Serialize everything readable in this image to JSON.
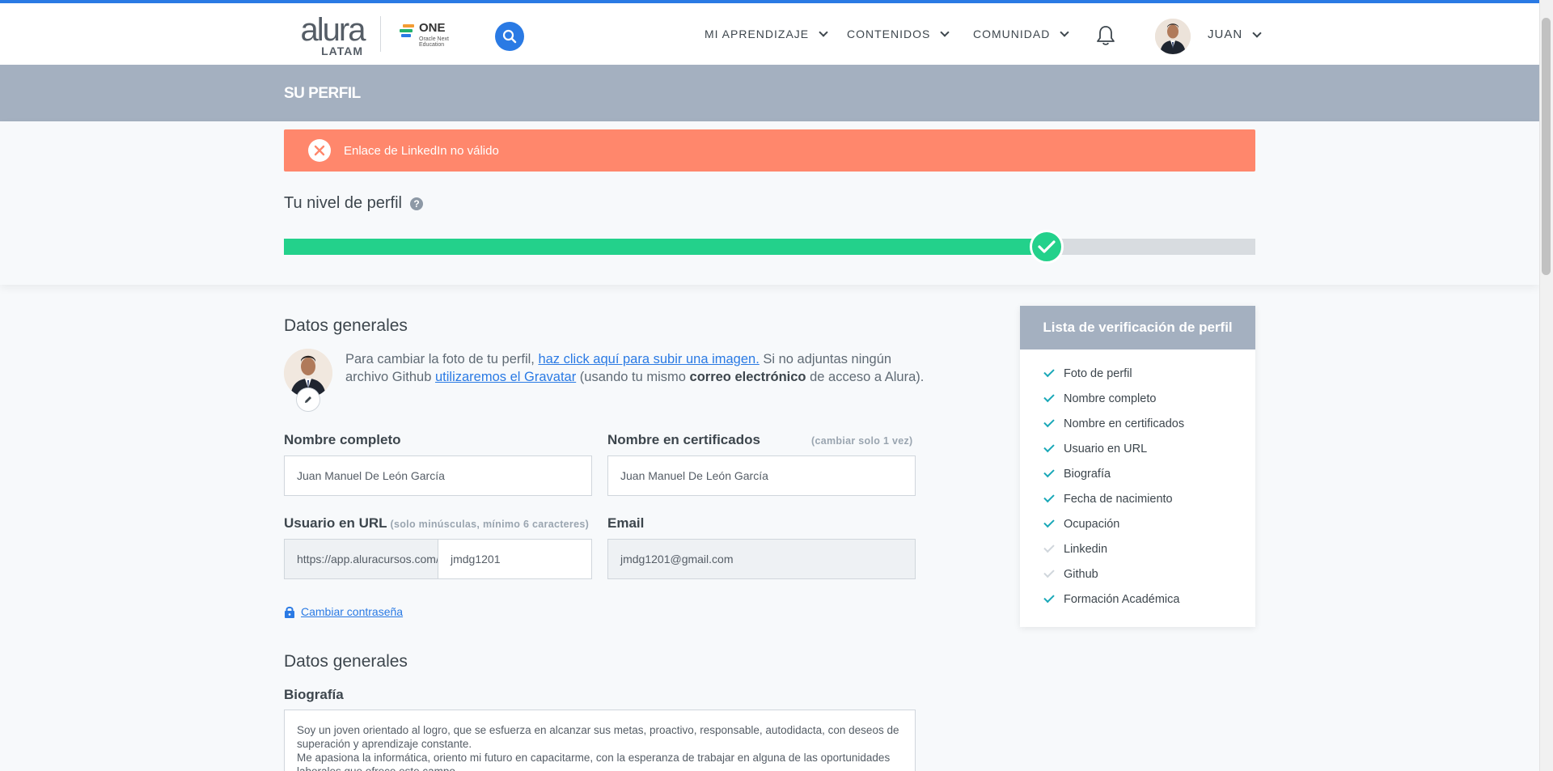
{
  "header": {
    "logo": {
      "alura": "alura",
      "latam": "LATAM"
    },
    "one_logo": {
      "title": "ONE",
      "subtitle": "Oracle Next Education"
    },
    "nav": [
      {
        "label": "MI APRENDIZAJE"
      },
      {
        "label": "CONTENIDOS"
      },
      {
        "label": "COMUNIDAD"
      }
    ],
    "user_name": "JUAN",
    "accent_color": "#2a7ae4"
  },
  "banner": {
    "title": "SU PERFIL"
  },
  "alert": {
    "message": "Enlace de LinkedIn no válido",
    "color": "#ff876c"
  },
  "profile_level": {
    "title": "Tu nivel de perfil",
    "help_glyph": "?",
    "progress_fraction": 0.785,
    "fill_color": "#23d18b"
  },
  "general": {
    "title": "Datos generales",
    "photo_text": {
      "part1": "Para cambiar la foto de tu perfil, ",
      "link1": "haz click aquí para subir una imagen.",
      "part2": " Si no adjuntas ningún archivo Github ",
      "link2": "utilizaremos el Gravatar",
      "part3": " (usando tu mismo ",
      "bold": "correo electrónico",
      "part4": " de acceso a Alura)."
    },
    "full_name": {
      "label": "Nombre completo",
      "value": "Juan Manuel De León García"
    },
    "cert_name": {
      "label": "Nombre en certificados",
      "hint": "(cambiar solo 1 vez)",
      "value": "Juan Manuel De León García"
    },
    "url_user": {
      "label": "Usuario en URL",
      "hint": "(solo minúsculas, mínimo 6 caracteres)",
      "prefix": "https://app.aluracursos.com/user/",
      "value": "jmdg1201"
    },
    "email": {
      "label": "Email",
      "value": "jmdg1201@gmail.com"
    },
    "change_password": "Cambiar contraseña"
  },
  "general2": {
    "title": "Datos generales",
    "bio": {
      "label": "Biografía",
      "value": "Soy un joven orientado al logro, que se esfuerza en alcanzar sus metas, proactivo, responsable, autodidacta, con deseos de superación y aprendizaje constante.\nMe apasiona la informática, oriento mi futuro en capacitarme, con la esperanza de trabajar en alguna de las oportunidades laborales que ofrece este campo."
    }
  },
  "checklist": {
    "title": "Lista de verificación de perfil",
    "items": [
      {
        "label": "Foto de perfil",
        "done": true
      },
      {
        "label": "Nombre completo",
        "done": true
      },
      {
        "label": "Nombre en certificados",
        "done": true
      },
      {
        "label": "Usuario en URL",
        "done": true
      },
      {
        "label": "Biografía",
        "done": true
      },
      {
        "label": "Fecha de nacimiento",
        "done": true
      },
      {
        "label": "Ocupación",
        "done": true
      },
      {
        "label": "Linkedin",
        "done": false
      },
      {
        "label": "Github",
        "done": false
      },
      {
        "label": "Formación Académica",
        "done": true
      }
    ]
  }
}
